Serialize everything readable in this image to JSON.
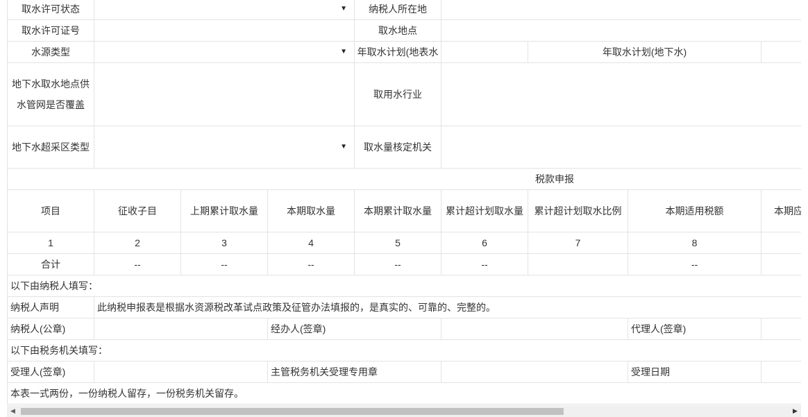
{
  "form": {
    "permit_status_label": "取水许可状态",
    "taxpayer_location_label": "纳税人所在地",
    "permit_no_label": "取水许可证号",
    "intake_location_label": "取水地点",
    "water_source_type_label": "水源类型",
    "annual_plan_surface_label": "年取水计划(地表水",
    "annual_plan_ground_label": "年取水计划(地下水)",
    "groundwater_pipe_label": "地下水取水地点供水管网是否覆盖",
    "water_industry_label": "取用水行业",
    "overdraft_zone_label": "地下水超采区类型",
    "verifying_authority_label": "取水量核定机关"
  },
  "icons": {
    "dropdown": "caret-down-icon",
    "scroll_left": "arrow-left-icon",
    "scroll_right": "arrow-right-icon"
  },
  "declaration": {
    "section_title": "税款申报",
    "columns": [
      "项目",
      "征收子目",
      "上期累计取水量",
      "本期取水量",
      "本期累计取水量",
      "累计超计划取水量",
      "累计超计划取水比例",
      "本期适用税额",
      "本期应"
    ],
    "numbers": [
      "1",
      "2",
      "3",
      "4",
      "5",
      "6",
      "7",
      "8"
    ],
    "total_label": "合计",
    "total_values": [
      "--",
      "--",
      "--",
      "--",
      "--",
      "--"
    ]
  },
  "taxpayer_section": {
    "title": "以下由纳税人填写：",
    "statement_label": "纳税人声明",
    "statement_text": "此纳税申报表是根据水资源税改革试点政策及征管办法填报的，是真实的、可靠的、完整的。",
    "seal_label": "纳税人(公章)",
    "handler_label": "经办人(签章)",
    "agent_label": "代理人(签章)"
  },
  "tax_office_section": {
    "title": "以下由税务机关填写：",
    "receiver_label": "受理人(签章)",
    "office_seal_label": "主管税务机关受理专用章",
    "date_label": "受理日期"
  },
  "footer_note": "本表一式两份，一份纳税人留存，一份税务机关留存。"
}
